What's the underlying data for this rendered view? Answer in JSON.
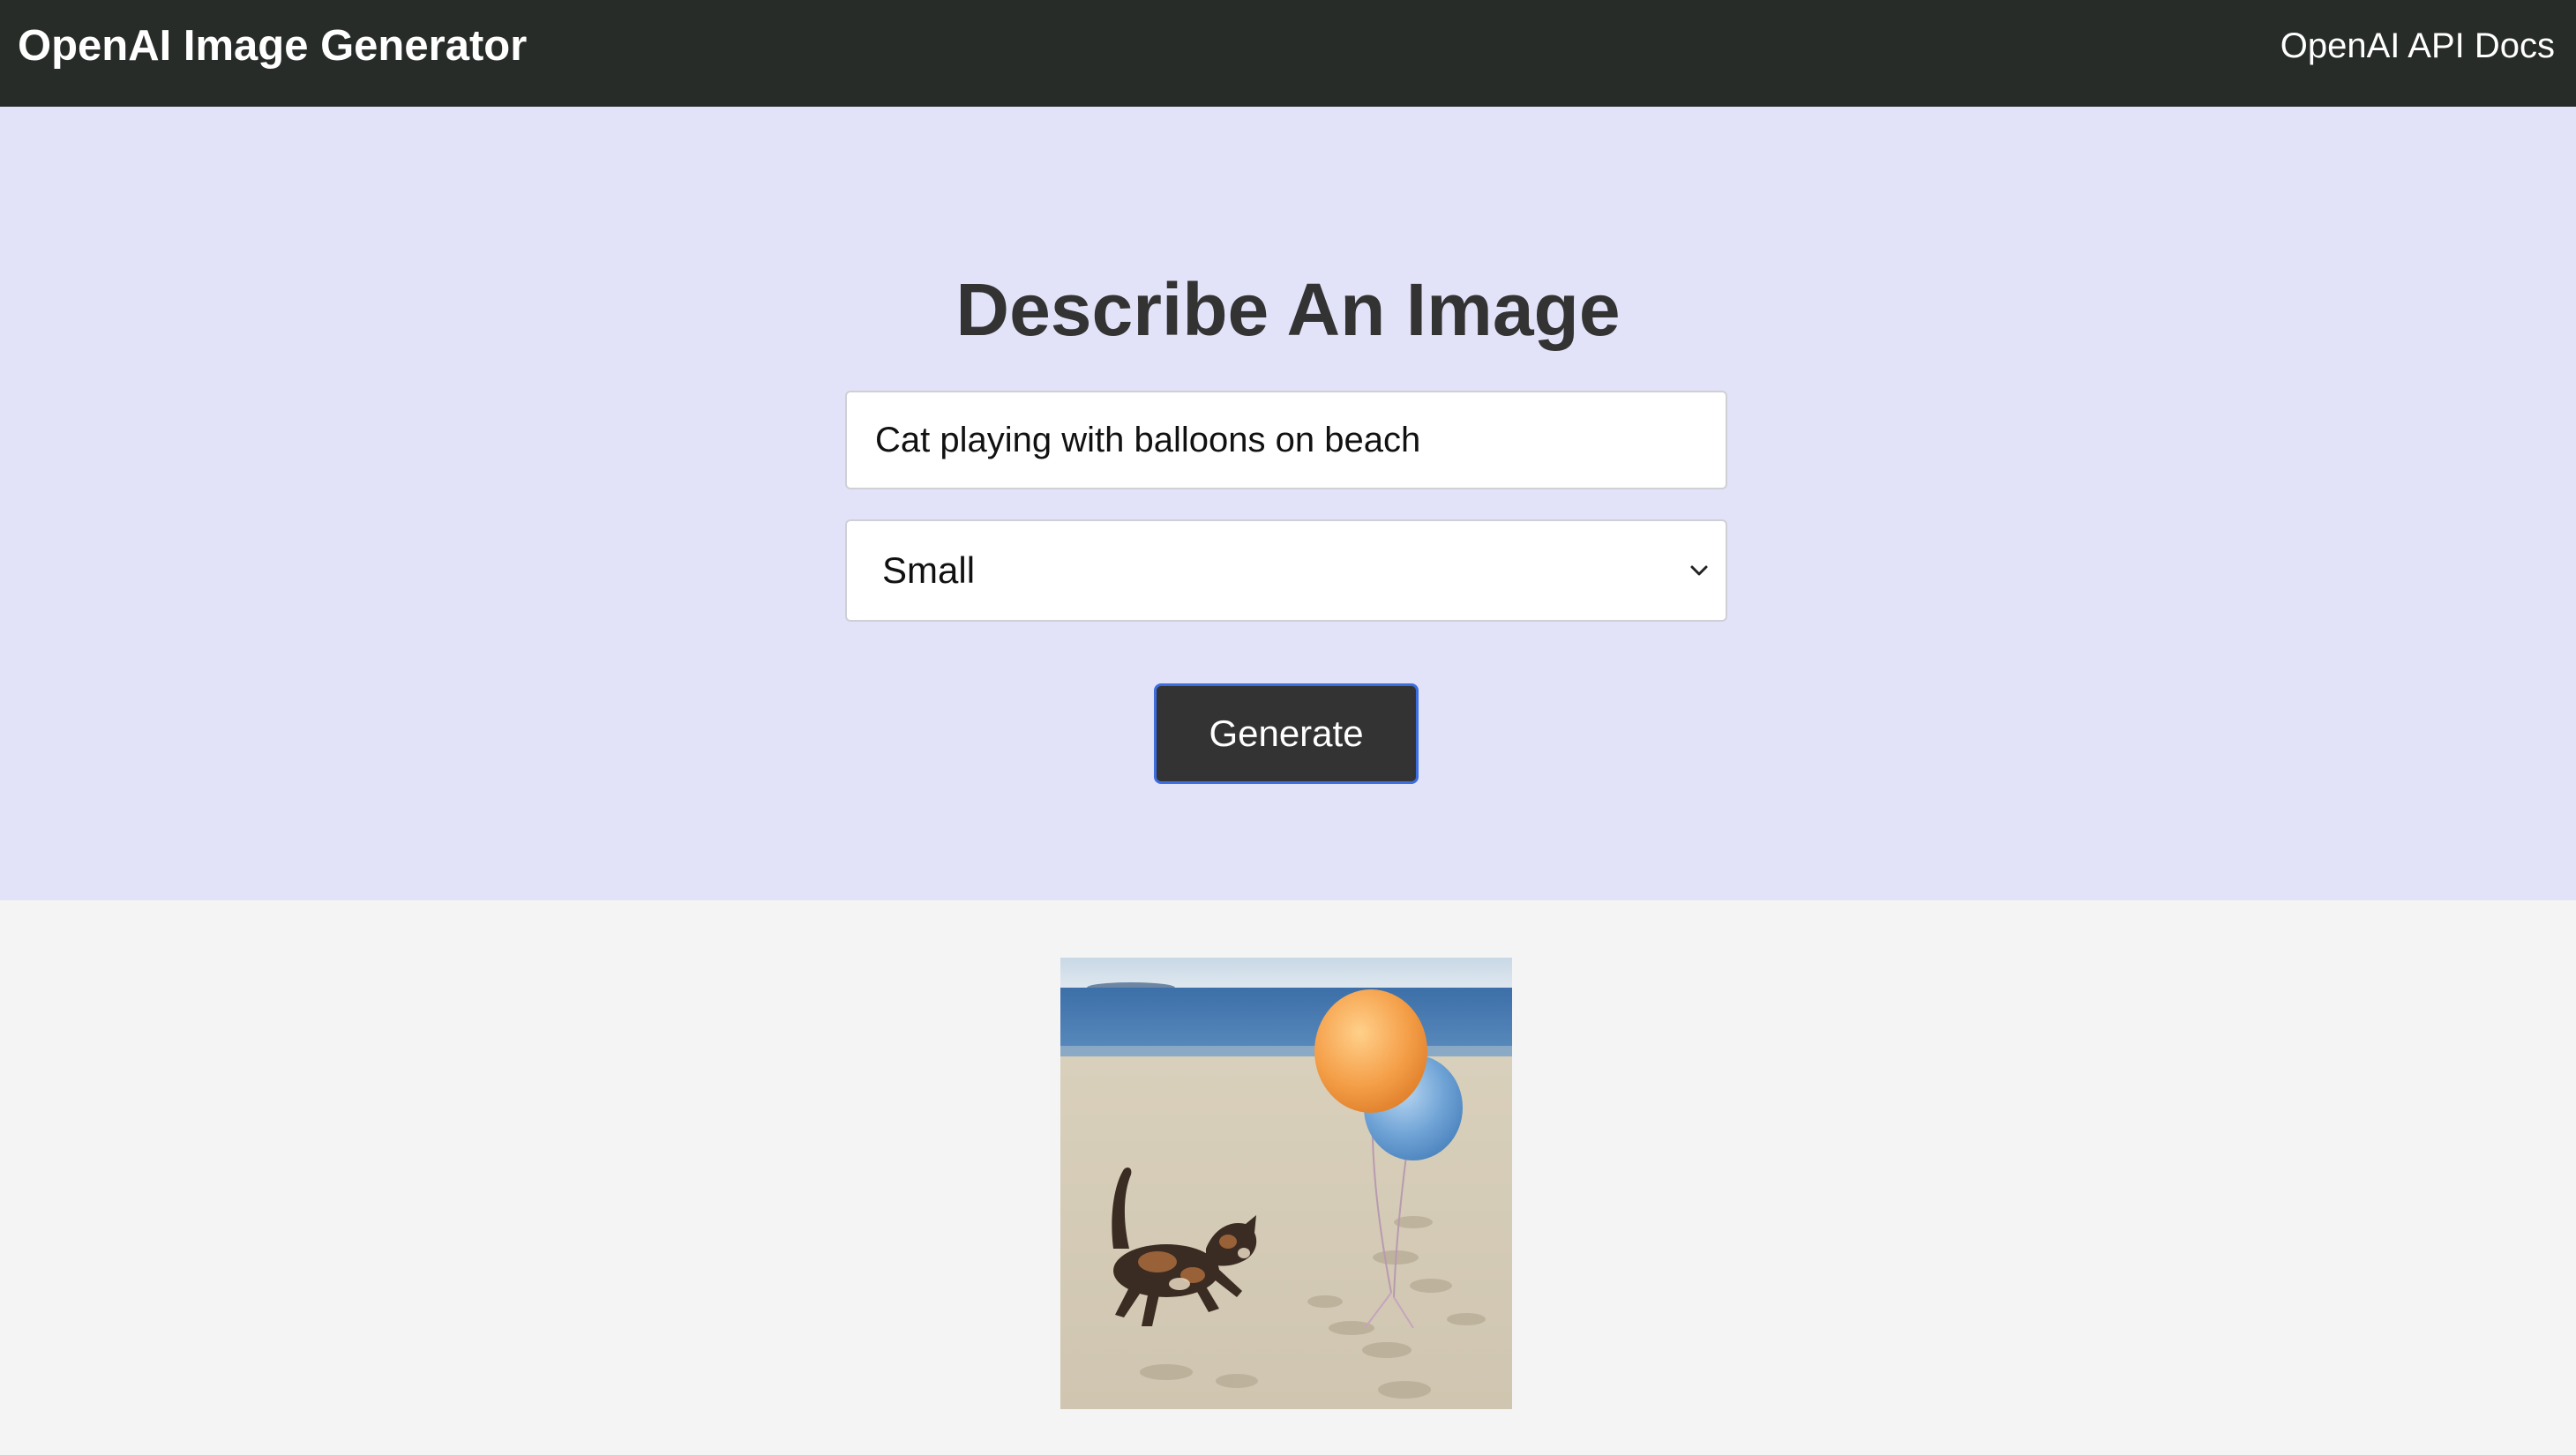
{
  "navbar": {
    "title": "OpenAI Image Generator",
    "docs_link": "OpenAI API Docs"
  },
  "hero": {
    "heading": "Describe An Image",
    "prompt_value": "Cat playing with balloons on beach",
    "size_selected": "Small",
    "generate_label": "Generate"
  },
  "result": {
    "image_icon": "generated-image"
  },
  "colors": {
    "navbar_bg": "#282c29",
    "hero_bg": "#e2e3f8",
    "page_bg": "#f4f4f4",
    "button_bg": "#333333",
    "button_border": "#3d6ee0"
  }
}
